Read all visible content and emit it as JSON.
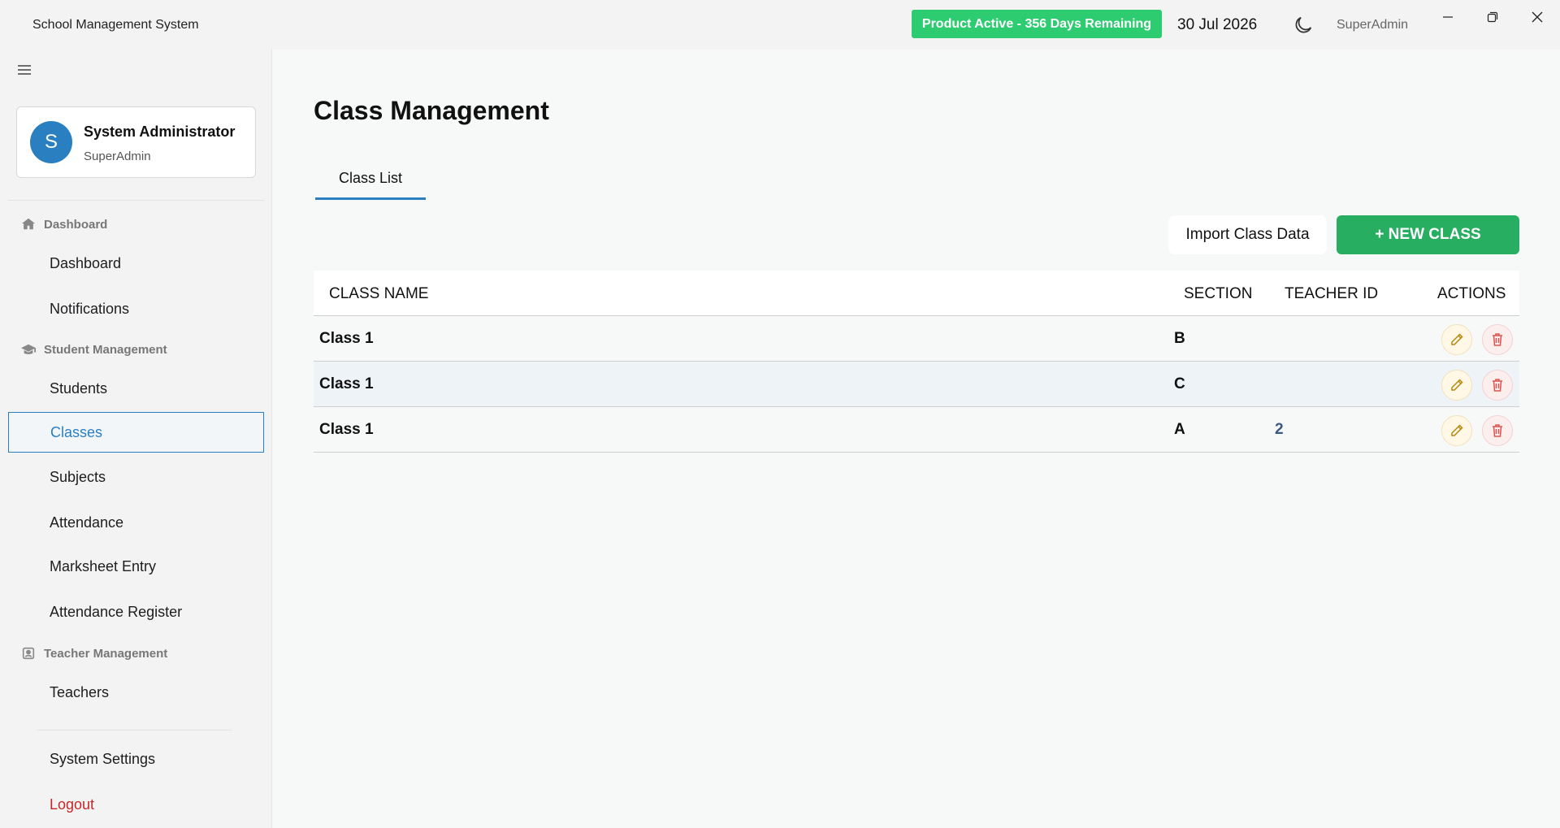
{
  "titlebar": {
    "app_title": "School Management System",
    "license_badge": "Product Active - 356 Days Remaining",
    "license_color": "#2ecc71",
    "date": "30 Jul 2026",
    "theme_icon": "moon-icon",
    "user": "SuperAdmin",
    "window_controls": [
      "minimize-icon",
      "maximize-icon",
      "close-icon"
    ]
  },
  "sidebar": {
    "profile": {
      "avatar_letter": "S",
      "name": "System Administrator",
      "role": "SuperAdmin",
      "avatar_color": "#2a7fc1"
    },
    "sections": {
      "dashboard": {
        "title": "Dashboard",
        "icon": "home-icon"
      },
      "student": {
        "title": "Student Management",
        "icon": "graduation-cap-icon"
      },
      "teacher": {
        "title": "Teacher Management",
        "icon": "id-badge-icon"
      }
    },
    "items": {
      "dashboard": "Dashboard",
      "notifications": "Notifications",
      "students": "Students",
      "classes": "Classes",
      "subjects": "Subjects",
      "attendance": "Attendance",
      "marksheet": "Marksheet Entry",
      "attendance_register": "Attendance Register",
      "teachers": "Teachers",
      "settings": "System Settings",
      "logout": "Logout"
    },
    "active_item": "Classes",
    "accent_color": "#2a7fc1"
  },
  "main": {
    "title": "Class Management",
    "tabs": [
      {
        "label": "Class List",
        "active": true
      }
    ],
    "import_label": "Import Class Data",
    "new_label": "+ NEW CLASS",
    "new_button_color": "#27ae60",
    "table": {
      "headers": [
        "CLASS NAME",
        "SECTION",
        "TEACHER ID",
        "ACTIONS"
      ],
      "rows": [
        {
          "name": "Class 1",
          "section": "B",
          "teacher_id": ""
        },
        {
          "name": "Class 1",
          "section": "C",
          "teacher_id": ""
        },
        {
          "name": "Class 1",
          "section": "A",
          "teacher_id": "2"
        }
      ],
      "row_actions": [
        "pencil-icon",
        "trash-icon"
      ]
    }
  }
}
